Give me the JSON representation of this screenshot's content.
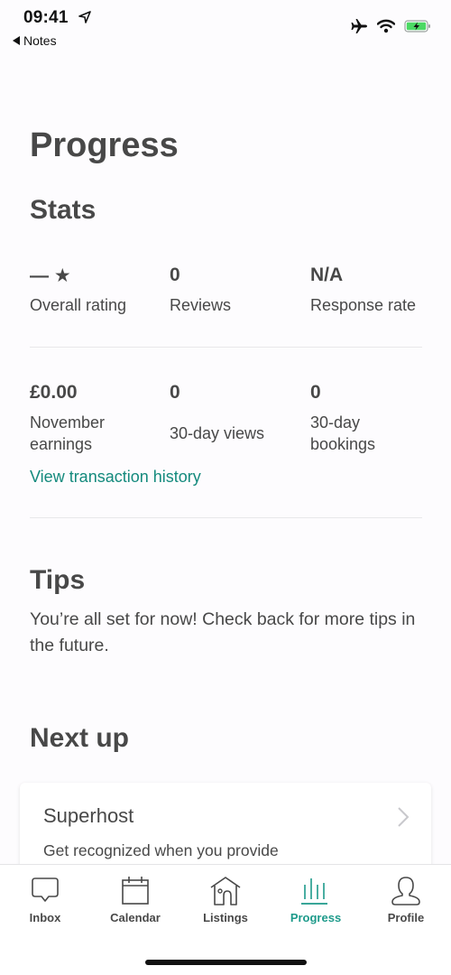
{
  "status_bar": {
    "time": "09:41",
    "back_label": "Notes",
    "icons": [
      "location-arrow-icon",
      "airplane-icon",
      "wifi-icon",
      "battery-charging-icon"
    ],
    "battery_color": "#4cd964"
  },
  "page": {
    "title": "Progress"
  },
  "stats": {
    "title": "Stats",
    "row1": [
      {
        "value": "— ★",
        "label": "Overall rating"
      },
      {
        "value": "0",
        "label": "Reviews"
      },
      {
        "value": "N/A",
        "label": "Response rate"
      }
    ],
    "row2": [
      {
        "value": "£0.00",
        "label": "November earnings"
      },
      {
        "value": "0",
        "label": "30-day views"
      },
      {
        "value": "0",
        "label": "30-day bookings"
      }
    ],
    "transaction_link": "View transaction history"
  },
  "tips": {
    "title": "Tips",
    "text": "You’re all set for now! Check back for more tips in the future."
  },
  "next_up": {
    "title": "Next up",
    "card": {
      "title": "Superhost",
      "description": "Get recognized when you provide"
    }
  },
  "tab_bar": {
    "tabs": [
      {
        "label": "Inbox",
        "icon": "inbox-icon"
      },
      {
        "label": "Calendar",
        "icon": "calendar-icon"
      },
      {
        "label": "Listings",
        "icon": "house-icon"
      },
      {
        "label": "Progress",
        "icon": "progress-bars-icon",
        "active": true
      },
      {
        "label": "Profile",
        "icon": "profile-icon"
      }
    ]
  },
  "colors": {
    "accent": "#148a7d",
    "active_tab": "#1d9a8a",
    "text": "#484848"
  }
}
